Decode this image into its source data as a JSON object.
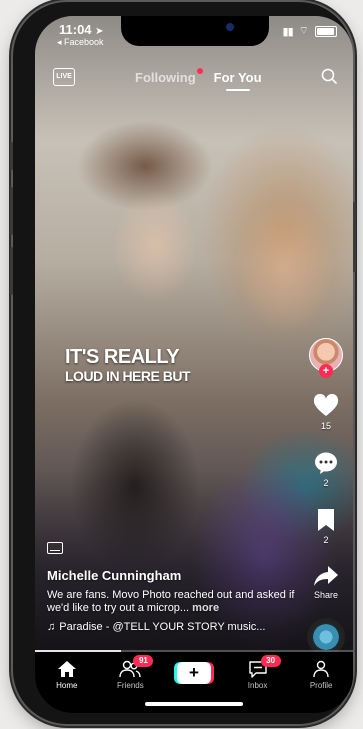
{
  "status": {
    "time": "11:04",
    "back_app": "◂ Facebook"
  },
  "topnav": {
    "live_label": "LIVE",
    "following": "Following",
    "for_you": "For You"
  },
  "overlay": {
    "line1": "IT'S REALLY",
    "line2": "LOUD IN HERE BUT"
  },
  "rail": {
    "likes": "15",
    "comments": "2",
    "saves": "2",
    "share": "Share"
  },
  "caption": {
    "username": "Michelle Cunningham",
    "description": "We are fans. Movo Photo reached out and asked if we'd like to try out a microp...",
    "more": "more",
    "music": "Paradise - @TELL YOUR STORY music..."
  },
  "progress": {
    "fraction": 0.27
  },
  "bottom_nav": {
    "home": "Home",
    "friends": "Friends",
    "friends_badge": "91",
    "create": "+",
    "inbox": "Inbox",
    "inbox_badge": "30",
    "profile": "Profile"
  },
  "colors": {
    "accent": "#fe2c55",
    "cyan": "#25f4ee",
    "bar": "#000000"
  }
}
